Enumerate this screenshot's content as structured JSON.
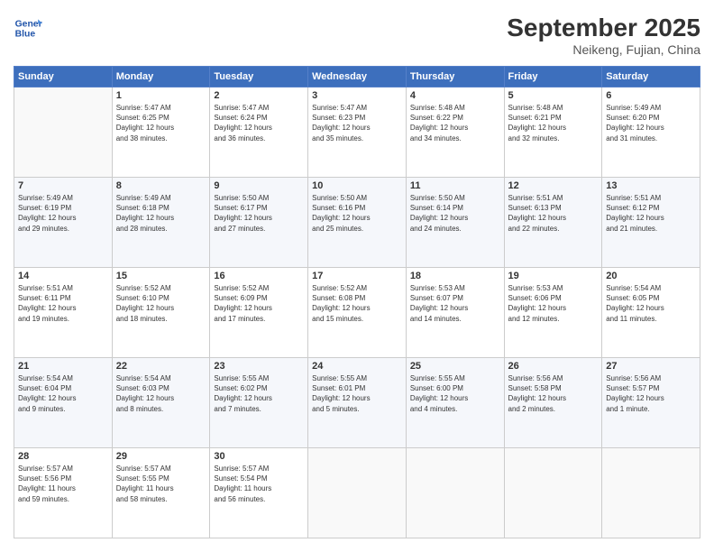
{
  "header": {
    "logo_line1": "General",
    "logo_line2": "Blue",
    "title": "September 2025",
    "subtitle": "Neikeng, Fujian, China"
  },
  "calendar": {
    "days_of_week": [
      "Sunday",
      "Monday",
      "Tuesday",
      "Wednesday",
      "Thursday",
      "Friday",
      "Saturday"
    ],
    "weeks": [
      [
        {
          "num": "",
          "text": ""
        },
        {
          "num": "1",
          "text": "Sunrise: 5:47 AM\nSunset: 6:25 PM\nDaylight: 12 hours\nand 38 minutes."
        },
        {
          "num": "2",
          "text": "Sunrise: 5:47 AM\nSunset: 6:24 PM\nDaylight: 12 hours\nand 36 minutes."
        },
        {
          "num": "3",
          "text": "Sunrise: 5:47 AM\nSunset: 6:23 PM\nDaylight: 12 hours\nand 35 minutes."
        },
        {
          "num": "4",
          "text": "Sunrise: 5:48 AM\nSunset: 6:22 PM\nDaylight: 12 hours\nand 34 minutes."
        },
        {
          "num": "5",
          "text": "Sunrise: 5:48 AM\nSunset: 6:21 PM\nDaylight: 12 hours\nand 32 minutes."
        },
        {
          "num": "6",
          "text": "Sunrise: 5:49 AM\nSunset: 6:20 PM\nDaylight: 12 hours\nand 31 minutes."
        }
      ],
      [
        {
          "num": "7",
          "text": "Sunrise: 5:49 AM\nSunset: 6:19 PM\nDaylight: 12 hours\nand 29 minutes."
        },
        {
          "num": "8",
          "text": "Sunrise: 5:49 AM\nSunset: 6:18 PM\nDaylight: 12 hours\nand 28 minutes."
        },
        {
          "num": "9",
          "text": "Sunrise: 5:50 AM\nSunset: 6:17 PM\nDaylight: 12 hours\nand 27 minutes."
        },
        {
          "num": "10",
          "text": "Sunrise: 5:50 AM\nSunset: 6:16 PM\nDaylight: 12 hours\nand 25 minutes."
        },
        {
          "num": "11",
          "text": "Sunrise: 5:50 AM\nSunset: 6:14 PM\nDaylight: 12 hours\nand 24 minutes."
        },
        {
          "num": "12",
          "text": "Sunrise: 5:51 AM\nSunset: 6:13 PM\nDaylight: 12 hours\nand 22 minutes."
        },
        {
          "num": "13",
          "text": "Sunrise: 5:51 AM\nSunset: 6:12 PM\nDaylight: 12 hours\nand 21 minutes."
        }
      ],
      [
        {
          "num": "14",
          "text": "Sunrise: 5:51 AM\nSunset: 6:11 PM\nDaylight: 12 hours\nand 19 minutes."
        },
        {
          "num": "15",
          "text": "Sunrise: 5:52 AM\nSunset: 6:10 PM\nDaylight: 12 hours\nand 18 minutes."
        },
        {
          "num": "16",
          "text": "Sunrise: 5:52 AM\nSunset: 6:09 PM\nDaylight: 12 hours\nand 17 minutes."
        },
        {
          "num": "17",
          "text": "Sunrise: 5:52 AM\nSunset: 6:08 PM\nDaylight: 12 hours\nand 15 minutes."
        },
        {
          "num": "18",
          "text": "Sunrise: 5:53 AM\nSunset: 6:07 PM\nDaylight: 12 hours\nand 14 minutes."
        },
        {
          "num": "19",
          "text": "Sunrise: 5:53 AM\nSunset: 6:06 PM\nDaylight: 12 hours\nand 12 minutes."
        },
        {
          "num": "20",
          "text": "Sunrise: 5:54 AM\nSunset: 6:05 PM\nDaylight: 12 hours\nand 11 minutes."
        }
      ],
      [
        {
          "num": "21",
          "text": "Sunrise: 5:54 AM\nSunset: 6:04 PM\nDaylight: 12 hours\nand 9 minutes."
        },
        {
          "num": "22",
          "text": "Sunrise: 5:54 AM\nSunset: 6:03 PM\nDaylight: 12 hours\nand 8 minutes."
        },
        {
          "num": "23",
          "text": "Sunrise: 5:55 AM\nSunset: 6:02 PM\nDaylight: 12 hours\nand 7 minutes."
        },
        {
          "num": "24",
          "text": "Sunrise: 5:55 AM\nSunset: 6:01 PM\nDaylight: 12 hours\nand 5 minutes."
        },
        {
          "num": "25",
          "text": "Sunrise: 5:55 AM\nSunset: 6:00 PM\nDaylight: 12 hours\nand 4 minutes."
        },
        {
          "num": "26",
          "text": "Sunrise: 5:56 AM\nSunset: 5:58 PM\nDaylight: 12 hours\nand 2 minutes."
        },
        {
          "num": "27",
          "text": "Sunrise: 5:56 AM\nSunset: 5:57 PM\nDaylight: 12 hours\nand 1 minute."
        }
      ],
      [
        {
          "num": "28",
          "text": "Sunrise: 5:57 AM\nSunset: 5:56 PM\nDaylight: 11 hours\nand 59 minutes."
        },
        {
          "num": "29",
          "text": "Sunrise: 5:57 AM\nSunset: 5:55 PM\nDaylight: 11 hours\nand 58 minutes."
        },
        {
          "num": "30",
          "text": "Sunrise: 5:57 AM\nSunset: 5:54 PM\nDaylight: 11 hours\nand 56 minutes."
        },
        {
          "num": "",
          "text": ""
        },
        {
          "num": "",
          "text": ""
        },
        {
          "num": "",
          "text": ""
        },
        {
          "num": "",
          "text": ""
        }
      ]
    ]
  }
}
